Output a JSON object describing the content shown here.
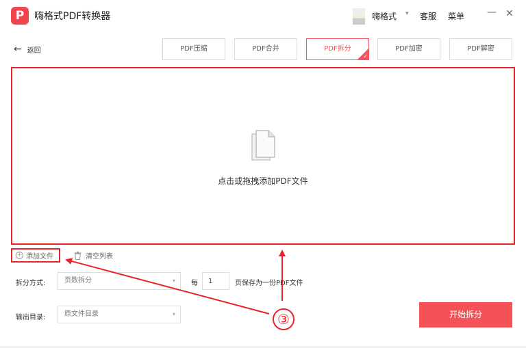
{
  "app": {
    "logo_glyph": "P",
    "title": "嗨格式PDF转换器"
  },
  "titlebar": {
    "user_name": "嗨格式",
    "user_caret": "▾",
    "service_label": "客服",
    "menu_label": "菜单",
    "minimize_glyph": "—",
    "close_glyph": "✕"
  },
  "nav": {
    "back_arrow": "←",
    "back_label": "返回"
  },
  "tabs": [
    {
      "label": "PDF压缩"
    },
    {
      "label": "PDF合并"
    },
    {
      "label": "PDF拆分",
      "active": true
    },
    {
      "label": "PDF加密"
    },
    {
      "label": "PDF解密"
    }
  ],
  "active_tab_check": "✓",
  "dropzone": {
    "text": "点击或拖拽添加PDF文件"
  },
  "file_actions": {
    "add_icon": "+",
    "add_label": "添加文件",
    "clear_label": "清空列表"
  },
  "split": {
    "mode_label": "拆分方式:",
    "mode_value": "页数拆分",
    "every_label": "每",
    "pages_value": "1",
    "pages_suffix": "页保存为一份PDF文件"
  },
  "output": {
    "label": "输出目录:",
    "value": "原文件目录"
  },
  "select_caret": "▾",
  "start_button": "开始拆分",
  "annotation": {
    "step": "③"
  },
  "colors": {
    "accent": "#f4555c",
    "highlight": "#e9232b",
    "button": "#f45258"
  }
}
